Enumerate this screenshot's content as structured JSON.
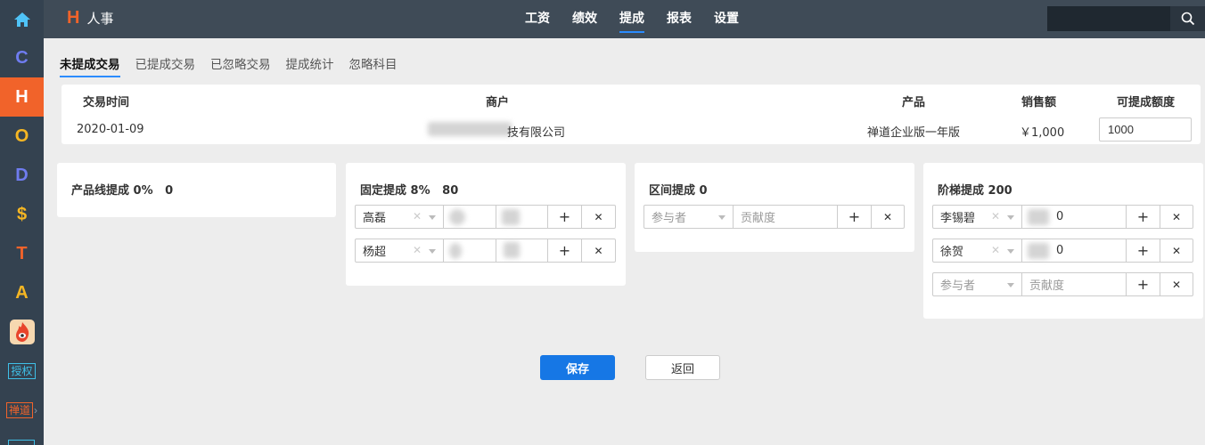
{
  "app": {
    "name": "人事",
    "brand_letter": "H"
  },
  "dock": {
    "items": [
      {
        "name": "home-icon",
        "label": "⌂",
        "color": "#4fc3f7"
      },
      {
        "name": "dock-item-c",
        "label": "C",
        "color": "#6f7cf0"
      },
      {
        "name": "dock-item-h",
        "label": "H",
        "color": "#ffffff"
      },
      {
        "name": "dock-item-o",
        "label": "O",
        "color": "#f5b623"
      },
      {
        "name": "dock-item-d",
        "label": "D",
        "color": "#6f7cf0"
      },
      {
        "name": "dock-item-s",
        "label": "$",
        "color": "#f5b623"
      },
      {
        "name": "dock-item-t",
        "label": "T",
        "color": "#f1632a"
      },
      {
        "name": "dock-item-a",
        "label": "A",
        "color": "#f5b623"
      }
    ],
    "auth_badge": "授权",
    "zentao_badge": "禅道"
  },
  "nav": {
    "items": [
      "工资",
      "绩效",
      "提成",
      "报表",
      "设置"
    ],
    "active": "提成"
  },
  "subtabs": {
    "items": [
      "未提成交易",
      "已提成交易",
      "已忽略交易",
      "提成统计",
      "忽略科目"
    ],
    "active": "未提成交易"
  },
  "transaction": {
    "headers": {
      "time": "交易时间",
      "merchant": "商户",
      "product": "产品",
      "sales": "销售额",
      "commission": "可提成额度"
    },
    "row": {
      "time": "2020-01-09",
      "merchant_suffix": "技有限公司",
      "product": "禅道企业版一年版",
      "sales": "￥1,000",
      "commission_value": "1000"
    }
  },
  "cards": {
    "product_line": {
      "title": "产品线提成 0%   0"
    },
    "fixed": {
      "title": "固定提成 8%   80",
      "rows": [
        {
          "person": "高磊"
        },
        {
          "person": "杨超"
        }
      ]
    },
    "range": {
      "title": "区间提成 0",
      "participant_placeholder": "参与者",
      "contribution_placeholder": "贡献度"
    },
    "tiered": {
      "title": "阶梯提成 200",
      "rows": [
        {
          "person": "李锡碧",
          "value_suffix": "0"
        },
        {
          "person": "徐贺",
          "value_suffix": "0"
        }
      ],
      "participant_placeholder": "参与者",
      "contribution_placeholder": "贡献度"
    }
  },
  "icons": {
    "add": "+",
    "remove": "✕",
    "clear": "✕"
  },
  "actions": {
    "save": "保存",
    "back": "返回"
  },
  "colors": {
    "primary": "#1677e5",
    "accent": "#f1632a",
    "topbar": "#3f4b57",
    "dock": "#344250"
  }
}
